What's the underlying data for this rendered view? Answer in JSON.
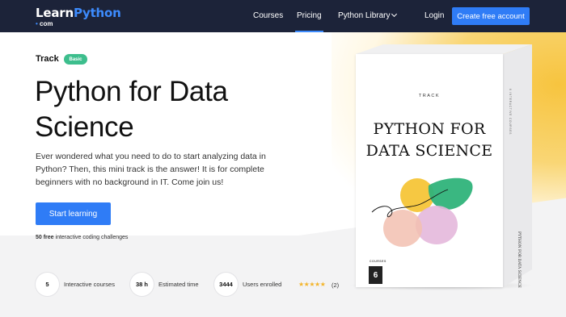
{
  "nav": {
    "logo_learn": "Learn",
    "logo_python": "Python",
    "logo_dot": "•",
    "logo_com": "com",
    "links": [
      "Courses",
      "Pricing",
      "Python Library"
    ],
    "login": "Login",
    "cta": "Create free account"
  },
  "hero": {
    "track_label": "Track",
    "level_badge": "Basic",
    "title": "Python for Data Science",
    "description": "Ever wondered what you need to do to start analyzing data in Python? Then, this mini track is the answer! It is for complete beginners with no background in IT. Come join us!",
    "start_button": "Start learning",
    "challenges_count": "50 free",
    "challenges_text": " interactive coding challenges"
  },
  "stats": [
    {
      "value": "5",
      "label": "Interactive courses"
    },
    {
      "value": "38 h",
      "label": "Estimated time"
    },
    {
      "value": "3444",
      "label": "Users enrolled"
    }
  ],
  "rating": {
    "stars": "★★★★★",
    "count": "(2)"
  },
  "box": {
    "track_word": "TRACK",
    "title_line1": "PYTHON FOR",
    "title_line2": "DATA SCIENCE",
    "courses_word": "COURSES",
    "courses_num": "6",
    "side_top": "6 INTERACTIVE COURSES",
    "side_bottom": "PYTHON FOR DATA SCIENCE"
  },
  "colors": {
    "nav_bg": "#1c2339",
    "accent": "#2f7cf6",
    "badge": "#3dbe8d",
    "star": "#f3b52c"
  }
}
